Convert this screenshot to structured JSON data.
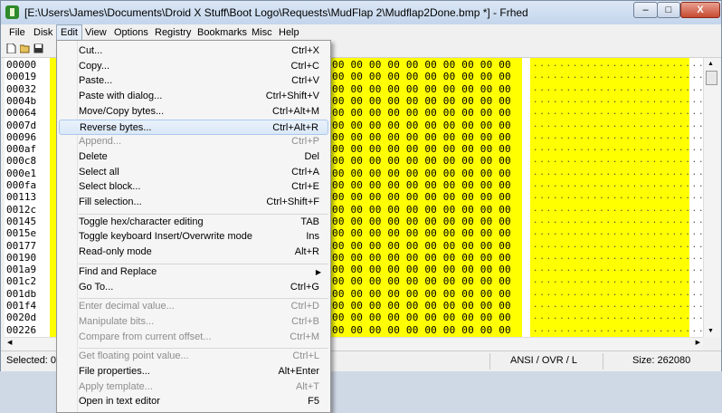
{
  "window": {
    "title": "[E:\\Users\\James\\Documents\\Droid X Stuff\\Boot Logo\\Requests\\MudFlap 2\\Mudflap2Done.bmp *] - Frhed",
    "min": "–",
    "max": "□",
    "close": "X"
  },
  "menubar": [
    "File",
    "Disk",
    "Edit",
    "View",
    "Options",
    "Registry",
    "Bookmarks",
    "Misc",
    "Help"
  ],
  "toolbar": {
    "icons": [
      "new-file-icon",
      "open-folder-icon",
      "save-icon"
    ]
  },
  "editor": {
    "addresses": [
      "00000",
      "00019",
      "00032",
      "0004b",
      "00064",
      "0007d",
      "00096",
      "000af",
      "000c8",
      "000e1",
      "000fa",
      "00113",
      "0012c",
      "00145",
      "0015e",
      "00177",
      "00190",
      "001a9",
      "001c2",
      "001db",
      "001f4",
      "0020d",
      "00226"
    ],
    "hex_row": "00 00 00 00 00 00 00 00 00 00 00",
    "ascii_row": "..........................",
    "highlight_color": "#ffff00"
  },
  "status": {
    "selected": "Selected: 0",
    "mode": "ANSI / OVR / L",
    "size": "Size: 262080"
  },
  "edit_menu": {
    "items": [
      {
        "label": "Cut...",
        "shortcut": "Ctrl+X",
        "enabled": true
      },
      {
        "label": "Copy...",
        "shortcut": "Ctrl+C",
        "enabled": true
      },
      {
        "label": "Paste...",
        "shortcut": "Ctrl+V",
        "enabled": true
      },
      {
        "label": "Paste with dialog...",
        "shortcut": "Ctrl+Shift+V",
        "enabled": true
      },
      {
        "label": "Move/Copy bytes...",
        "shortcut": "Ctrl+Alt+M",
        "enabled": true
      },
      {
        "label": "Reverse bytes...",
        "shortcut": "Ctrl+Alt+R",
        "enabled": true,
        "highlighted": true
      },
      {
        "label": "Append...",
        "shortcut": "Ctrl+P",
        "enabled": false
      },
      {
        "label": "Delete",
        "shortcut": "Del",
        "enabled": true
      },
      {
        "label": "Select all",
        "shortcut": "Ctrl+A",
        "enabled": true
      },
      {
        "label": "Select block...",
        "shortcut": "Ctrl+E",
        "enabled": true
      },
      {
        "label": "Fill selection...",
        "shortcut": "Ctrl+Shift+F",
        "enabled": true
      },
      {
        "separator": true
      },
      {
        "label": "Toggle hex/character editing",
        "shortcut": "TAB",
        "enabled": true
      },
      {
        "label": "Toggle keyboard Insert/Overwrite mode",
        "shortcut": "Ins",
        "enabled": true
      },
      {
        "label": "Read-only mode",
        "shortcut": "Alt+R",
        "enabled": true
      },
      {
        "separator": true
      },
      {
        "label": "Find and Replace",
        "shortcut": "",
        "enabled": true,
        "submenu": true
      },
      {
        "label": "Go To...",
        "shortcut": "Ctrl+G",
        "enabled": true
      },
      {
        "separator": true
      },
      {
        "label": "Enter decimal value...",
        "shortcut": "Ctrl+D",
        "enabled": false
      },
      {
        "label": "Manipulate bits...",
        "shortcut": "Ctrl+B",
        "enabled": false
      },
      {
        "label": "Compare from current offset...",
        "shortcut": "Ctrl+M",
        "enabled": false
      },
      {
        "separator": true
      },
      {
        "label": "Get floating point value...",
        "shortcut": "Ctrl+L",
        "enabled": false
      },
      {
        "label": "File properties...",
        "shortcut": "Alt+Enter",
        "enabled": true
      },
      {
        "label": "Apply template...",
        "shortcut": "Alt+T",
        "enabled": false
      },
      {
        "label": "Open in text editor",
        "shortcut": "F5",
        "enabled": true
      }
    ]
  }
}
